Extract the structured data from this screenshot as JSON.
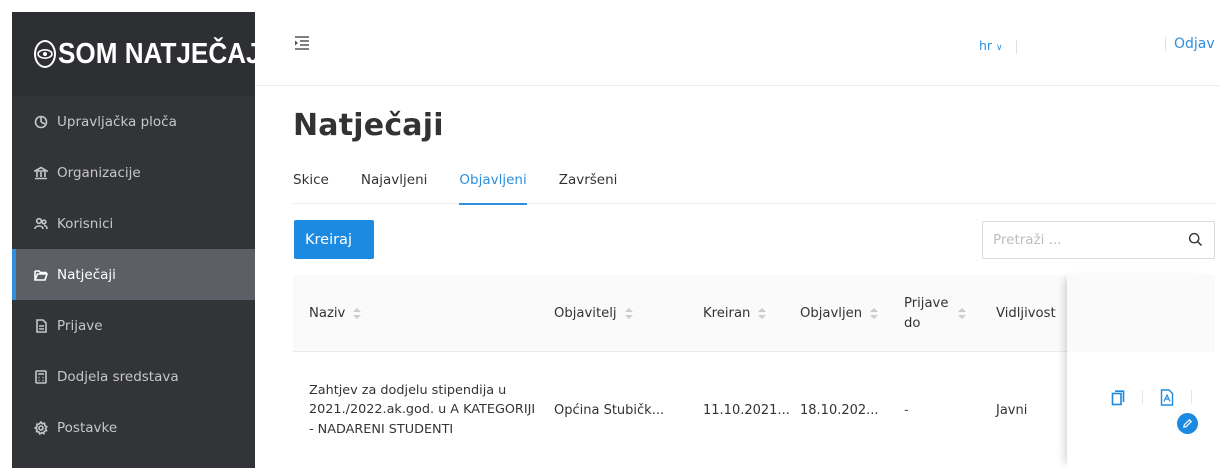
{
  "app": {
    "logo_text": "SOM NATJEČAJI"
  },
  "sidebar": {
    "items": [
      {
        "label": "Upravljačka ploča",
        "icon": "dashboard-icon",
        "active": false
      },
      {
        "label": "Organizacije",
        "icon": "bank-icon",
        "active": false
      },
      {
        "label": "Korisnici",
        "icon": "users-icon",
        "active": false
      },
      {
        "label": "Natječaji",
        "icon": "folder-open-icon",
        "active": true
      },
      {
        "label": "Prijave",
        "icon": "document-icon",
        "active": false
      },
      {
        "label": "Dodjela sredstava",
        "icon": "calculator-icon",
        "active": false
      },
      {
        "label": "Postavke",
        "icon": "settings-icon",
        "active": false
      }
    ]
  },
  "header": {
    "language": "hr",
    "logout_label": "Odjav"
  },
  "main": {
    "title": "Natječaji",
    "tabs": [
      {
        "label": "Skice",
        "active": false
      },
      {
        "label": "Najavljeni",
        "active": false
      },
      {
        "label": "Objavljeni",
        "active": true
      },
      {
        "label": "Završeni",
        "active": false
      }
    ],
    "create_label": "Kreiraj",
    "search_placeholder": "Pretraži ..."
  },
  "table": {
    "columns": [
      "Naziv",
      "Objavitelj",
      "Kreiran",
      "Objavljen",
      "Prijave do",
      "Vidljivost"
    ],
    "rows": [
      {
        "naziv": "Zahtjev za dodjelu stipendija u 2021./2022.ak.god. u A KATEGORIJI - NADARENI STUDENTI",
        "objavitelj": "Općina Stubičk...",
        "kreiran": "11.10.2021...",
        "objavljen": "18.10.202...",
        "prijave_do": "-",
        "vidljivost": "Javni"
      }
    ]
  },
  "colors": {
    "accent": "#1c8ae0",
    "sidebar_bg": "#333438",
    "sidebar_active": "#5d5f66"
  }
}
